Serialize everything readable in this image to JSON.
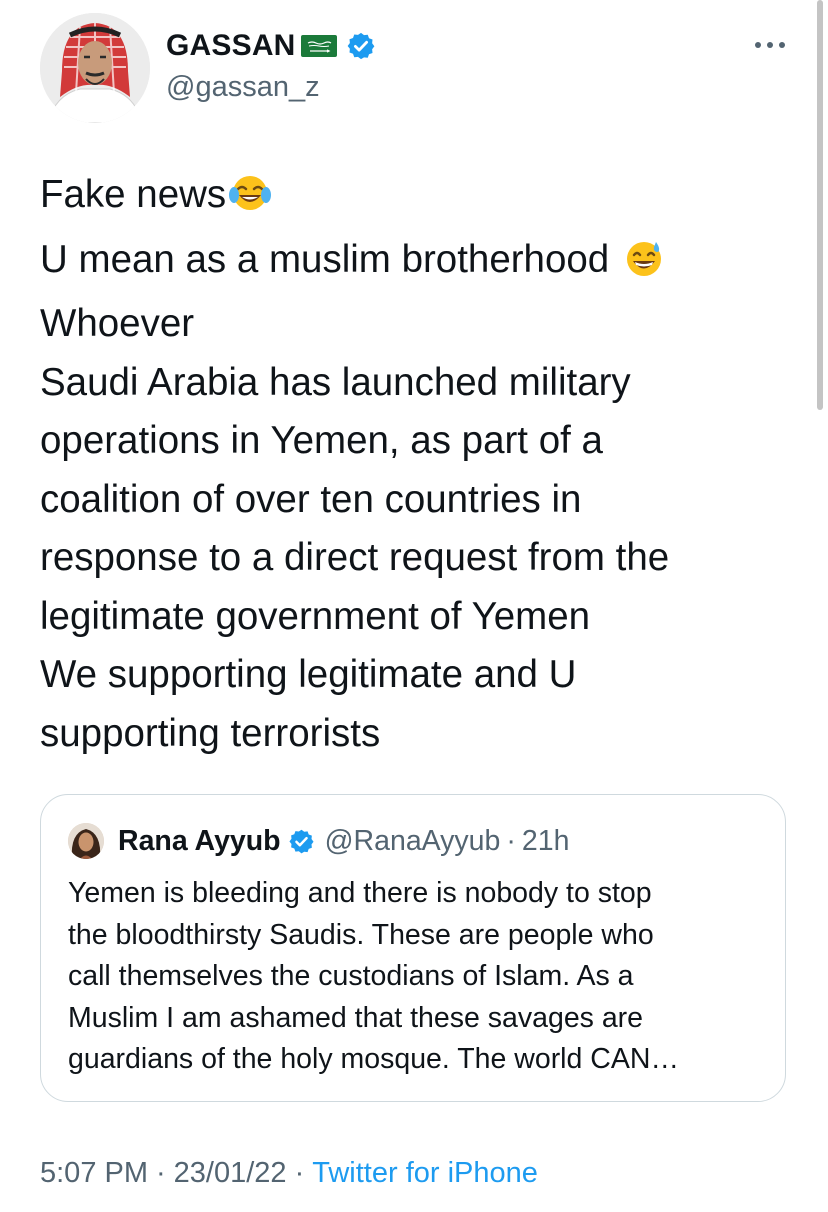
{
  "author": {
    "display_name": "GASSAN",
    "handle": "@gassan_z"
  },
  "tweet": {
    "lines": [
      "Fake news",
      "U mean as a muslim brotherhood ",
      "Whoever",
      "Saudi Arabia has launched military",
      "operations in Yemen, as part of a",
      "coalition of over ten countries in",
      "response to a direct request from the",
      "legitimate government of Yemen",
      "We supporting legitimate and U",
      "supporting terrorists"
    ]
  },
  "quoted_tweet": {
    "display_name": "Rana Ayyub",
    "handle": "@RanaAyyub",
    "separator": "·",
    "time": "21h",
    "lines": [
      "Yemen is bleeding and there is nobody to stop",
      "the bloodthirsty Saudis. These are people who",
      "call themselves the custodians of Islam. As a",
      "Muslim I am ashamed that these savages are",
      "guardians of the holy mosque. The world CAN…"
    ]
  },
  "meta": {
    "time": "5:07 PM",
    "dot1": "·",
    "date": "23/01/22",
    "dot2": "·",
    "source": "Twitter for iPhone"
  },
  "icons": {
    "verified": "verified-badge-icon",
    "flag": "saudi-flag-emoji",
    "laughing": "face-with-tears-of-joy-emoji",
    "sweat_smile": "grinning-face-with-sweat-emoji",
    "more": "more-options-icon"
  },
  "colors": {
    "text": "#0f1419",
    "secondary": "#536471",
    "link": "#1d9bf0",
    "border": "#cfd9de",
    "verified": "#1d9bf0",
    "flag_green": "#1b7a3a"
  }
}
